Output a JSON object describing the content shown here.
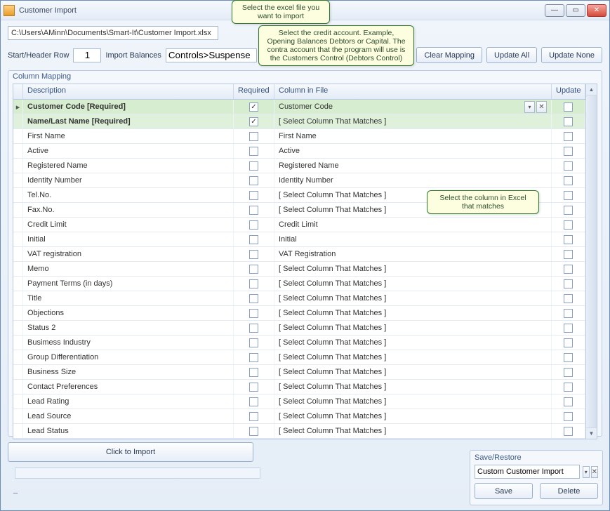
{
  "window": {
    "title": "Customer Import"
  },
  "file_path": "C:\\Users\\AMinn\\Documents\\Smart-It\\Customer Import.xlsx",
  "labels": {
    "start_header_row": "Start/Header Row",
    "import_balances": "Import Balances",
    "column_mapping": "Column Mapping",
    "save_restore": "Save/Restore"
  },
  "values": {
    "start_header_row": "1",
    "import_balances": "Controls>Suspense",
    "save_restore_name": "Custom Customer Import"
  },
  "buttons": {
    "clear_mapping": "Clear Mapping",
    "update_all": "Update All",
    "update_none": "Update None",
    "click_to_import": "Click to Import",
    "save": "Save",
    "delete": "Delete"
  },
  "grid": {
    "headers": {
      "description": "Description",
      "required": "Required",
      "column_in_file": "Column in File",
      "update": "Update"
    },
    "rows": [
      {
        "desc": "Customer Code [Required]",
        "required": true,
        "col": "Customer Code",
        "bold": true,
        "highlight": true,
        "selected": true,
        "showDropdown": true
      },
      {
        "desc": "Name/Last Name [Required]",
        "required": true,
        "col": "[ Select Column That Matches ]",
        "bold": true,
        "highlight": true
      },
      {
        "desc": "First Name",
        "required": false,
        "col": "First Name"
      },
      {
        "desc": "Active",
        "required": false,
        "col": "Active"
      },
      {
        "desc": "Registered Name",
        "required": false,
        "col": "Registered Name"
      },
      {
        "desc": "Identity Number",
        "required": false,
        "col": "Identity Number"
      },
      {
        "desc": "Tel.No.",
        "required": false,
        "col": "[ Select Column That Matches ]"
      },
      {
        "desc": "Fax.No.",
        "required": false,
        "col": "[ Select Column That Matches ]"
      },
      {
        "desc": "Credit Limit",
        "required": false,
        "col": "Credit Limit"
      },
      {
        "desc": "Initial",
        "required": false,
        "col": "Initial"
      },
      {
        "desc": "VAT registration",
        "required": false,
        "col": "VAT Registration"
      },
      {
        "desc": "Memo",
        "required": false,
        "col": "[ Select Column That Matches ]"
      },
      {
        "desc": "Payment Terms (in days)",
        "required": false,
        "col": "[ Select Column That Matches ]"
      },
      {
        "desc": "Title",
        "required": false,
        "col": "[ Select Column That Matches ]"
      },
      {
        "desc": "Objections",
        "required": false,
        "col": "[ Select Column That Matches ]"
      },
      {
        "desc": "Status 2",
        "required": false,
        "col": "[ Select Column That Matches ]"
      },
      {
        "desc": "Busimess Industry",
        "required": false,
        "col": "[ Select Column That Matches ]"
      },
      {
        "desc": "Group Differentiation",
        "required": false,
        "col": "[ Select Column That Matches ]"
      },
      {
        "desc": "Business Size",
        "required": false,
        "col": "[ Select Column That Matches ]"
      },
      {
        "desc": "Contact Preferences",
        "required": false,
        "col": "[ Select Column That Matches ]"
      },
      {
        "desc": "Lead Rating",
        "required": false,
        "col": "[ Select Column That Matches ]"
      },
      {
        "desc": "Lead Source",
        "required": false,
        "col": "[ Select Column That Matches ]"
      },
      {
        "desc": "Lead Status",
        "required": false,
        "col": "[ Select Column That Matches ]"
      }
    ]
  },
  "callouts": {
    "c1": "Select the excel file you want to import",
    "c2": "Select the credit account. Example, Opening Balances Debtors or Capital. The contra account that the program will use is  the Customers Control (Debtors Control)",
    "c3": "Select the column in Excel that matches"
  },
  "status_sep": "_"
}
